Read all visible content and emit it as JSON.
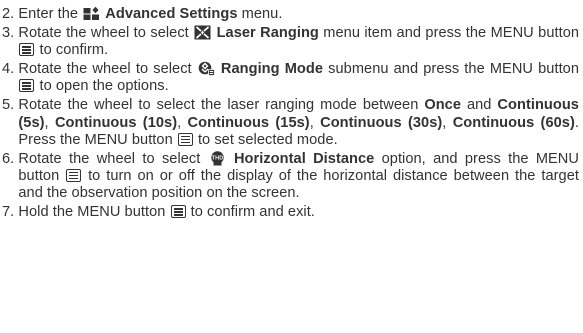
{
  "steps": [
    {
      "num": "2. ",
      "parts": [
        "Enter the ",
        "Advanced Settings",
        " menu."
      ]
    },
    {
      "num": "3. ",
      "parts": [
        "Rotate the wheel to select ",
        "Laser Ranging",
        " menu item and press the MENU button ",
        " to confirm."
      ]
    },
    {
      "num": "4. ",
      "parts": [
        "Rotate the wheel to select ",
        "Ranging Mode",
        " submenu and press the MENU button ",
        " to open the options."
      ]
    },
    {
      "num": "5. ",
      "parts": [
        "Rotate the wheel to select the laser ranging mode between ",
        "Once",
        " and ",
        "Continuous (5s)",
        ", ",
        "Continuous (10s)",
        ", ",
        "Continuous (15s)",
        ", ",
        "Continuous (30s)",
        ", ",
        "Continuous (60s)",
        ". Press the MENU button ",
        " to set selected mode."
      ]
    },
    {
      "num": "6. ",
      "parts": [
        "Rotate the wheel to select ",
        "Horizontal Distance",
        " option, and press the MENU button ",
        " to turn on or off the display of the horizontal distance between the target and the observation position on the screen."
      ]
    },
    {
      "num": "7. ",
      "parts": [
        "Hold the MENU button ",
        " to confirm and exit."
      ]
    }
  ],
  "icons": {
    "advanced_settings": "advanced-settings-icon",
    "laser_ranging": "laser-ranging-icon",
    "ranging_mode": "ranging-mode-icon",
    "horizontal_distance": "horizontal-distance-icon",
    "horizontal_distance_text": "THD",
    "menu_button": "menu-button-icon"
  },
  "colors": {
    "text": "#333333"
  }
}
